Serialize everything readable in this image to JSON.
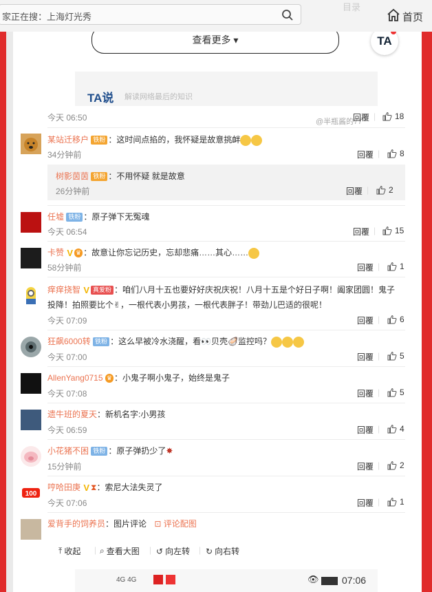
{
  "topbar": {
    "search_text": "家正在搜：上海灯光秀",
    "nav_faint": "目录",
    "home_label": "首页"
  },
  "card": {
    "more_label": "查看更多",
    "ta_logo": "TA",
    "band_logo": "TA说",
    "band_sub": "解读网络最后的知识",
    "watermark": "@半瓶酱的77",
    "time": "今天 06:50",
    "reply": "回覆",
    "likes": "18"
  },
  "comments": [
    {
      "name": "某站迁移户",
      "badges": [
        "铁粉"
      ],
      "text": "：这时间点掐的，我怀疑是故意挑衅",
      "time": "34分钟前",
      "reply": "回覆",
      "likes": "8"
    },
    {
      "name": "树影茵茵",
      "badges": [
        "铁粉"
      ],
      "text": "：不用怀疑 就是故意",
      "time": "26分钟前",
      "reply": "回覆",
      "likes": "2",
      "is_sub": true
    },
    {
      "name": "任墟",
      "badges": [
        "铁粉"
      ],
      "text": "：原子弹下无冤魂",
      "time": "今天 06:54",
      "reply": "回覆",
      "likes": "15"
    },
    {
      "name": "卡赞",
      "badges": [
        "V"
      ],
      "text": "：故意让你忘记历史，忘却悲痛……其心……",
      "time": "58分钟前",
      "reply": "回覆",
      "likes": "1"
    },
    {
      "name": "痒痒挠智",
      "badges": [
        "V",
        "真爱粉"
      ],
      "text": "：咱们八月十五也要好好庆祝庆祝！八月十五是个好日子啊！阖家团圆！鬼子",
      "text2": "投降！拍照要比个✌，一根代表小男孩，一根代表胖子！带劲儿巴适的很呢！",
      "time": "今天 07:09",
      "reply": "回覆",
      "likes": "6"
    },
    {
      "name": "狂飙6000转",
      "badges": [
        "铁粉"
      ],
      "text": "：这么早被冷水浇醒，看👀贝壳🦪监控吗？",
      "time": "今天 07:00",
      "reply": "回覆",
      "likes": "5"
    },
    {
      "name": "AllenYang0715",
      "badges": [],
      "text": "：小鬼子啊小鬼子，始终是鬼子",
      "time": "今天 07:08",
      "reply": "回覆",
      "likes": "5"
    },
    {
      "name": "遗牛班的夏天",
      "badges": [],
      "text": "：新机名字:小男孩",
      "time": "今天 06:59",
      "reply": "回覆",
      "likes": "4"
    },
    {
      "name": "小花猪不困",
      "badges": [
        "铁粉"
      ],
      "text": "：原子弹扔少了",
      "time": "15分钟前",
      "reply": "回覆",
      "likes": "2"
    },
    {
      "name": "哼哈田庚",
      "badges": [
        "V"
      ],
      "text": "：索尼大法失灵了",
      "time": "今天 07:06",
      "reply": "回覆",
      "likes": "1"
    },
    {
      "name": "爱背手的饲养员",
      "badges": [],
      "text": "：图片评论",
      "link": "评论配图"
    }
  ],
  "image_tools": {
    "collapse": "收起",
    "view_large": "查看大图",
    "rotate_left": "向左转",
    "rotate_right": "向右转"
  },
  "phone_status": {
    "signal": "4G 4G",
    "time": "07:06"
  }
}
